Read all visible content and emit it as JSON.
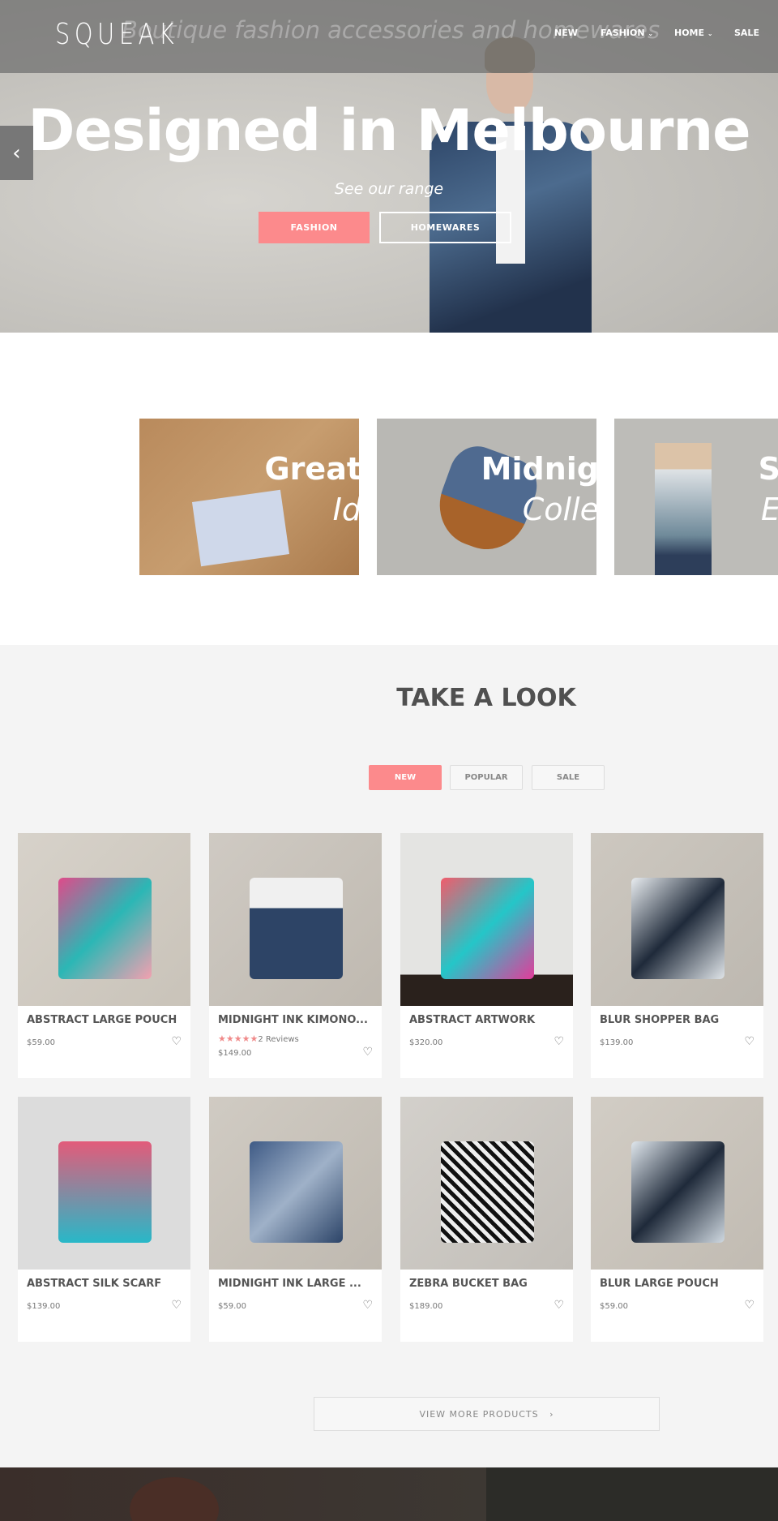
{
  "header": {
    "logo": "SQUEAK",
    "tagline": "Boutique fashion accessories and homewares",
    "nav": [
      {
        "label": "NEW",
        "dropdown": false
      },
      {
        "label": "FASHION",
        "dropdown": true
      },
      {
        "label": "HOME",
        "dropdown": true
      },
      {
        "label": "SALE",
        "dropdown": false
      }
    ]
  },
  "hero": {
    "title": "Designed in Melbourne",
    "subtitle": "See our range",
    "buttons": [
      "FASHION",
      "HOMEWARES"
    ],
    "prev_icon": "chevron-left-icon"
  },
  "collections": [
    {
      "title": "Great",
      "subtitle": "Id"
    },
    {
      "title": "Midnig",
      "subtitle": "Colle"
    },
    {
      "title": "S",
      "subtitle": "E"
    }
  ],
  "products_section": {
    "title": "TAKE A LOOK",
    "tabs": [
      {
        "label": "NEW",
        "active": true
      },
      {
        "label": "POPULAR",
        "active": false
      },
      {
        "label": "SALE",
        "active": false
      }
    ],
    "products": [
      {
        "name": "ABSTRACT LARGE POUCH",
        "price": "$59.00"
      },
      {
        "name": "MIDNIGHT INK KIMONO...",
        "price": "$149.00",
        "rating": 5,
        "reviews": "2 Reviews"
      },
      {
        "name": "ABSTRACT ARTWORK",
        "price": "$320.00"
      },
      {
        "name": "BLUR SHOPPER BAG",
        "price": "$139.00"
      },
      {
        "name": "ABSTRACT SILK SCARF",
        "price": "$139.00"
      },
      {
        "name": "MIDNIGHT INK LARGE ...",
        "price": "$59.00"
      },
      {
        "name": "ZEBRA BUCKET BAG",
        "price": "$189.00"
      },
      {
        "name": "BLUR LARGE POUCH",
        "price": "$59.00"
      }
    ],
    "view_more": "VIEW MORE PRODUCTS"
  },
  "colors": {
    "accent": "#fc8a8c",
    "heading": "#505050",
    "background": "#f4f4f4"
  }
}
